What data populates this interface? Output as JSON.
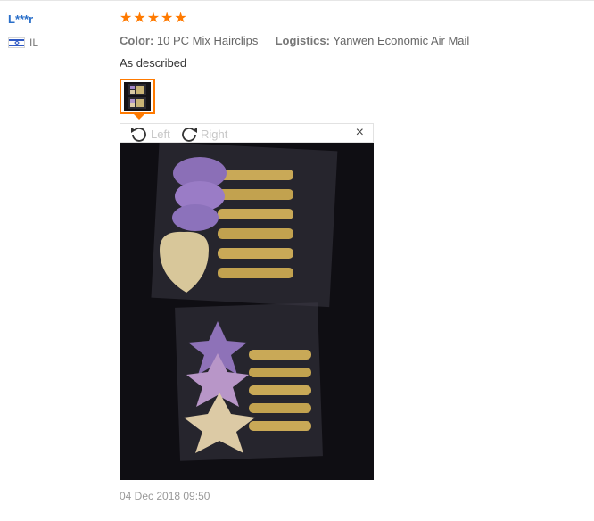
{
  "buyer": {
    "name": "L***r",
    "country": "IL",
    "flag_icon": "israel-flag-icon"
  },
  "rating": {
    "stars": 5,
    "max": 5,
    "color": "#ff7a00"
  },
  "order_info": {
    "color_label": "Color:",
    "color_value": "10 PC Mix Hairclips",
    "logistics_label": "Logistics:",
    "logistics_value": "Yanwen Economic Air Mail"
  },
  "feedback_text": "As described",
  "image_viewer": {
    "rotate_left_label": "Left",
    "rotate_right_label": "Right",
    "close_label": "×",
    "accent_color": "#ff7a00"
  },
  "date": "04 Dec 2018 09:50"
}
